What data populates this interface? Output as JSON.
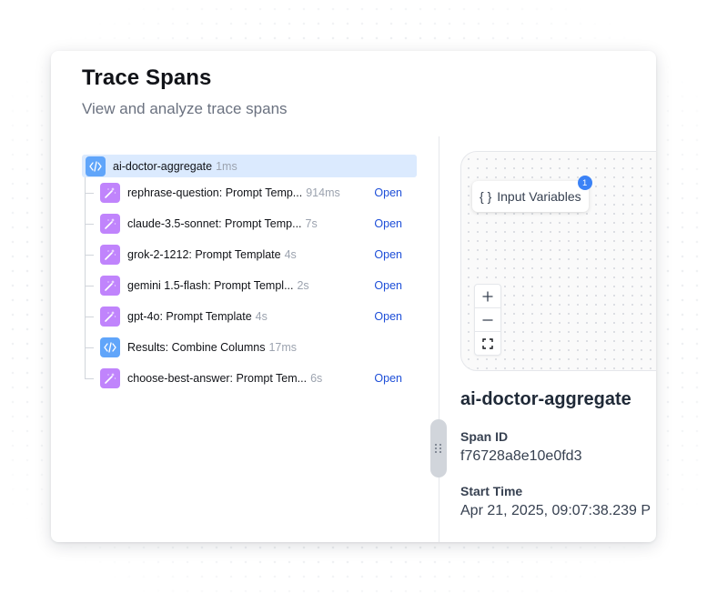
{
  "header": {
    "title": "Trace Spans",
    "subtitle": "View and analyze trace spans"
  },
  "tree": {
    "root": {
      "name": "ai-doctor-aggregate",
      "duration": "1ms",
      "icon": "code-icon"
    },
    "children": [
      {
        "name": "rephrase-question: Prompt Temp...",
        "duration": "914ms",
        "icon": "magic-wand-icon",
        "action": "Open"
      },
      {
        "name": "claude-3.5-sonnet: Prompt Temp...",
        "duration": "7s",
        "icon": "magic-wand-icon",
        "action": "Open"
      },
      {
        "name": "grok-2-1212: Prompt Template",
        "duration": "4s",
        "icon": "magic-wand-icon",
        "action": "Open"
      },
      {
        "name": "gemini 1.5-flash: Prompt Templ...",
        "duration": "2s",
        "icon": "magic-wand-icon",
        "action": "Open"
      },
      {
        "name": "gpt-4o: Prompt Template",
        "duration": "4s",
        "icon": "magic-wand-icon",
        "action": "Open"
      },
      {
        "name": "Results: Combine Columns",
        "duration": "17ms",
        "icon": "code-icon",
        "action": ""
      },
      {
        "name": "choose-best-answer: Prompt Tem...",
        "duration": "6s",
        "icon": "magic-wand-icon",
        "action": "Open"
      }
    ]
  },
  "canvas": {
    "node_braces": "{ }",
    "node_label": "Input Variables",
    "node_badge": "1",
    "zoom_controls": [
      "plus-icon",
      "minus-icon",
      "fit-view-icon"
    ]
  },
  "details": {
    "title": "ai-doctor-aggregate",
    "span_id_label": "Span ID",
    "span_id_value": "f76728a8e10e0fd3",
    "start_time_label": "Start Time",
    "start_time_value": "Apr 21, 2025, 09:07:38.239 P"
  },
  "colors": {
    "selected_row": "#dbeafe",
    "code_icon": "#60a5fa",
    "prompt_icon": "#c084fc",
    "link": "#1d4ed8",
    "badge": "#3b82f6"
  }
}
